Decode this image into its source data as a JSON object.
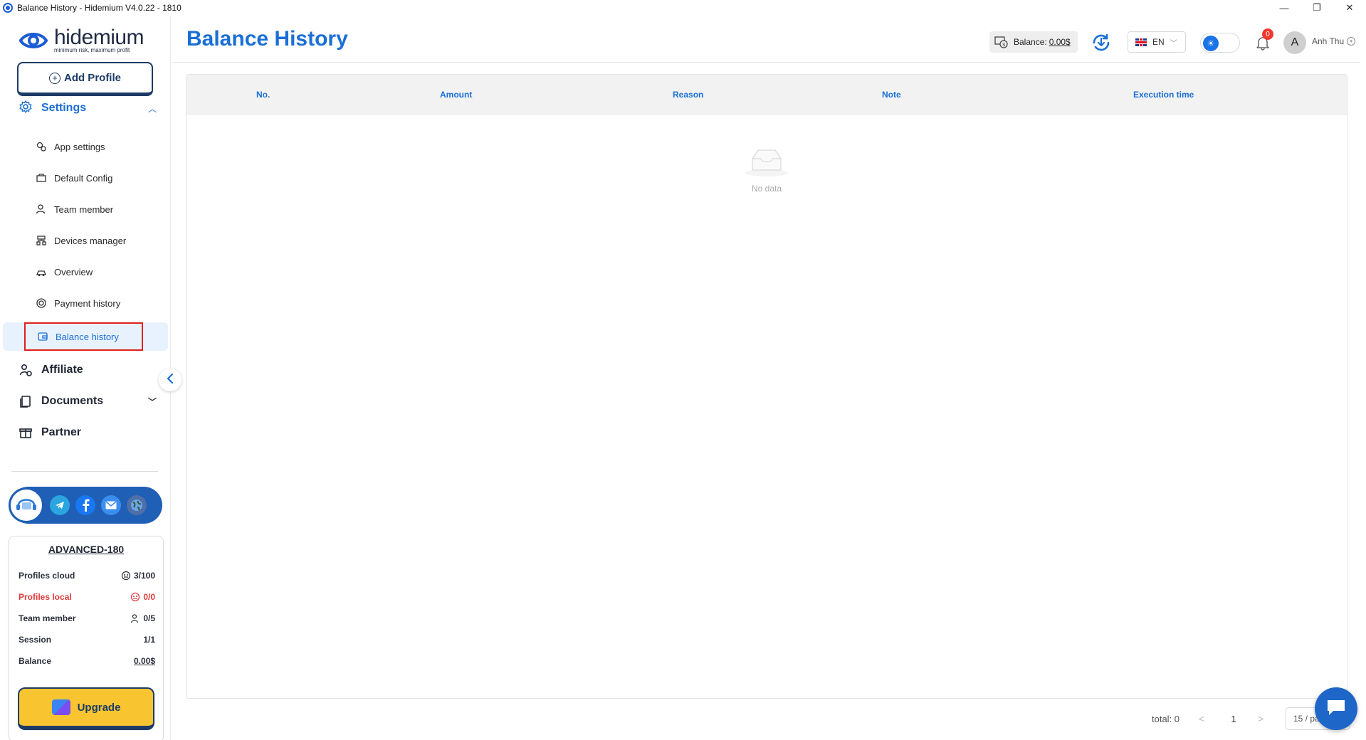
{
  "window": {
    "title": "Balance History - Hidemium V4.0.22 - 1810",
    "controls": {
      "minimize": "—",
      "maximize": "❐",
      "close": "✕"
    }
  },
  "logo": {
    "name": "hidemium",
    "tagline": "minimum risk, maximum profit"
  },
  "sidebar": {
    "add_profile_label": "Add Profile",
    "settings_label": "Settings",
    "settings_items": [
      {
        "label": "App settings",
        "icon": "gears-icon"
      },
      {
        "label": "Default Config",
        "icon": "config-icon"
      },
      {
        "label": "Team member",
        "icon": "users-icon"
      },
      {
        "label": "Devices manager",
        "icon": "devices-icon"
      },
      {
        "label": "Overview",
        "icon": "overview-icon"
      },
      {
        "label": "Payment history",
        "icon": "payment-icon"
      },
      {
        "label": "Balance history",
        "icon": "wallet-icon"
      }
    ],
    "affiliate_label": "Affiliate",
    "documents_label": "Documents",
    "partner_label": "Partner"
  },
  "plan": {
    "name": "ADVANCED-180",
    "rows": [
      {
        "label": "Profiles cloud",
        "value": "3/100"
      },
      {
        "label": "Profiles local",
        "value": "0/0"
      },
      {
        "label": "Team member",
        "value": "0/5"
      },
      {
        "label": "Session",
        "value": "1/1"
      },
      {
        "label": "Balance",
        "value": "0.00$"
      }
    ],
    "upgrade_label": "Upgrade"
  },
  "header": {
    "page_title": "Balance History",
    "balance_label": "Balance:",
    "balance_value": "0.00$",
    "language": "EN",
    "notification_count": "0",
    "avatar_initial": "A",
    "user_name": "Anh Thu"
  },
  "table": {
    "columns": [
      "No.",
      "Amount",
      "Reason",
      "Note",
      "Execution time"
    ],
    "empty_text": "No data"
  },
  "pagination": {
    "total": "total: 0",
    "current_page": "1",
    "per_page": "15 / page"
  },
  "colors": {
    "accent": "#1a6fd6",
    "navy": "#1d3b66",
    "upgrade": "#f8c531",
    "danger": "#e03a3a"
  }
}
